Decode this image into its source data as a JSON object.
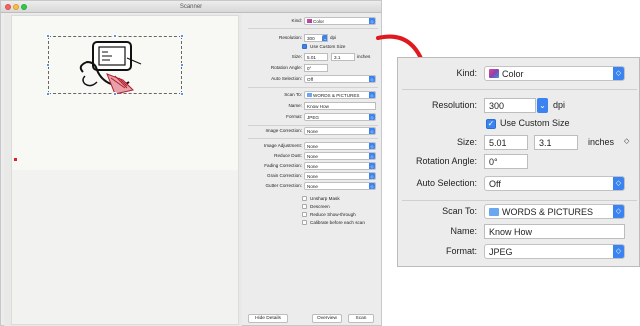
{
  "window": {
    "title": "Scanner"
  },
  "small_panel": {
    "kind": {
      "label": "Kind:",
      "value": "Color"
    },
    "resolution": {
      "label": "Resolution:",
      "value": "300",
      "unit": "dpi"
    },
    "use_custom_size": {
      "label": "Use Custom Size",
      "checked": true
    },
    "size": {
      "label": "Size:",
      "width": "5.01",
      "height": "3.1",
      "unit": "inches"
    },
    "rotation": {
      "label": "Rotation Angle:",
      "value": "0°"
    },
    "auto_selection": {
      "label": "Auto Selection:",
      "value": "Off"
    },
    "scan_to": {
      "label": "Scan To:",
      "value": "WORDS & PICTURES"
    },
    "name": {
      "label": "Name:",
      "value": "Know How"
    },
    "format": {
      "label": "Format:",
      "value": "JPEG"
    },
    "image_correction": {
      "label": "Image Correction:",
      "value": "None"
    },
    "image_adjustment": {
      "label": "Image Adjustment:",
      "value": "None"
    },
    "reduce_dust": {
      "label": "Reduce Dust:",
      "value": "None"
    },
    "fading_correction": {
      "label": "Fading Correction:",
      "value": "None"
    },
    "grain_correction": {
      "label": "Grain Correction:",
      "value": "None"
    },
    "gutter_correction": {
      "label": "Gutter Correction:",
      "value": "None"
    },
    "checkboxes": [
      "Unsharp Mask",
      "Descreen",
      "Reduce Show-through",
      "Calibrate before each scan"
    ],
    "buttons": {
      "hide_details": "Hide Details",
      "overview": "Overview",
      "scan": "Scan"
    }
  },
  "zoom_panel": {
    "kind": {
      "label": "Kind:",
      "value": "Color"
    },
    "resolution": {
      "label": "Resolution:",
      "value": "300",
      "unit": "dpi"
    },
    "use_custom_size": {
      "label": "Use Custom Size",
      "checked": true
    },
    "size": {
      "label": "Size:",
      "width": "5.01",
      "height": "3.1",
      "unit": "inches"
    },
    "rotation": {
      "label": "Rotation Angle:",
      "value": "0°"
    },
    "auto_selection": {
      "label": "Auto Selection:",
      "value": "Off"
    },
    "scan_to": {
      "label": "Scan To:",
      "value": "WORDS & PICTURES"
    },
    "name": {
      "label": "Name:",
      "value": "Know How"
    },
    "format": {
      "label": "Format:",
      "value": "JPEG"
    }
  },
  "glyphs": {
    "popup_arrow": "⌃⌄",
    "stepper": "⌄",
    "check": "✓",
    "ud": "◇"
  },
  "colors": {
    "accent": "#3a83f1",
    "arrow": "#e0191f"
  }
}
